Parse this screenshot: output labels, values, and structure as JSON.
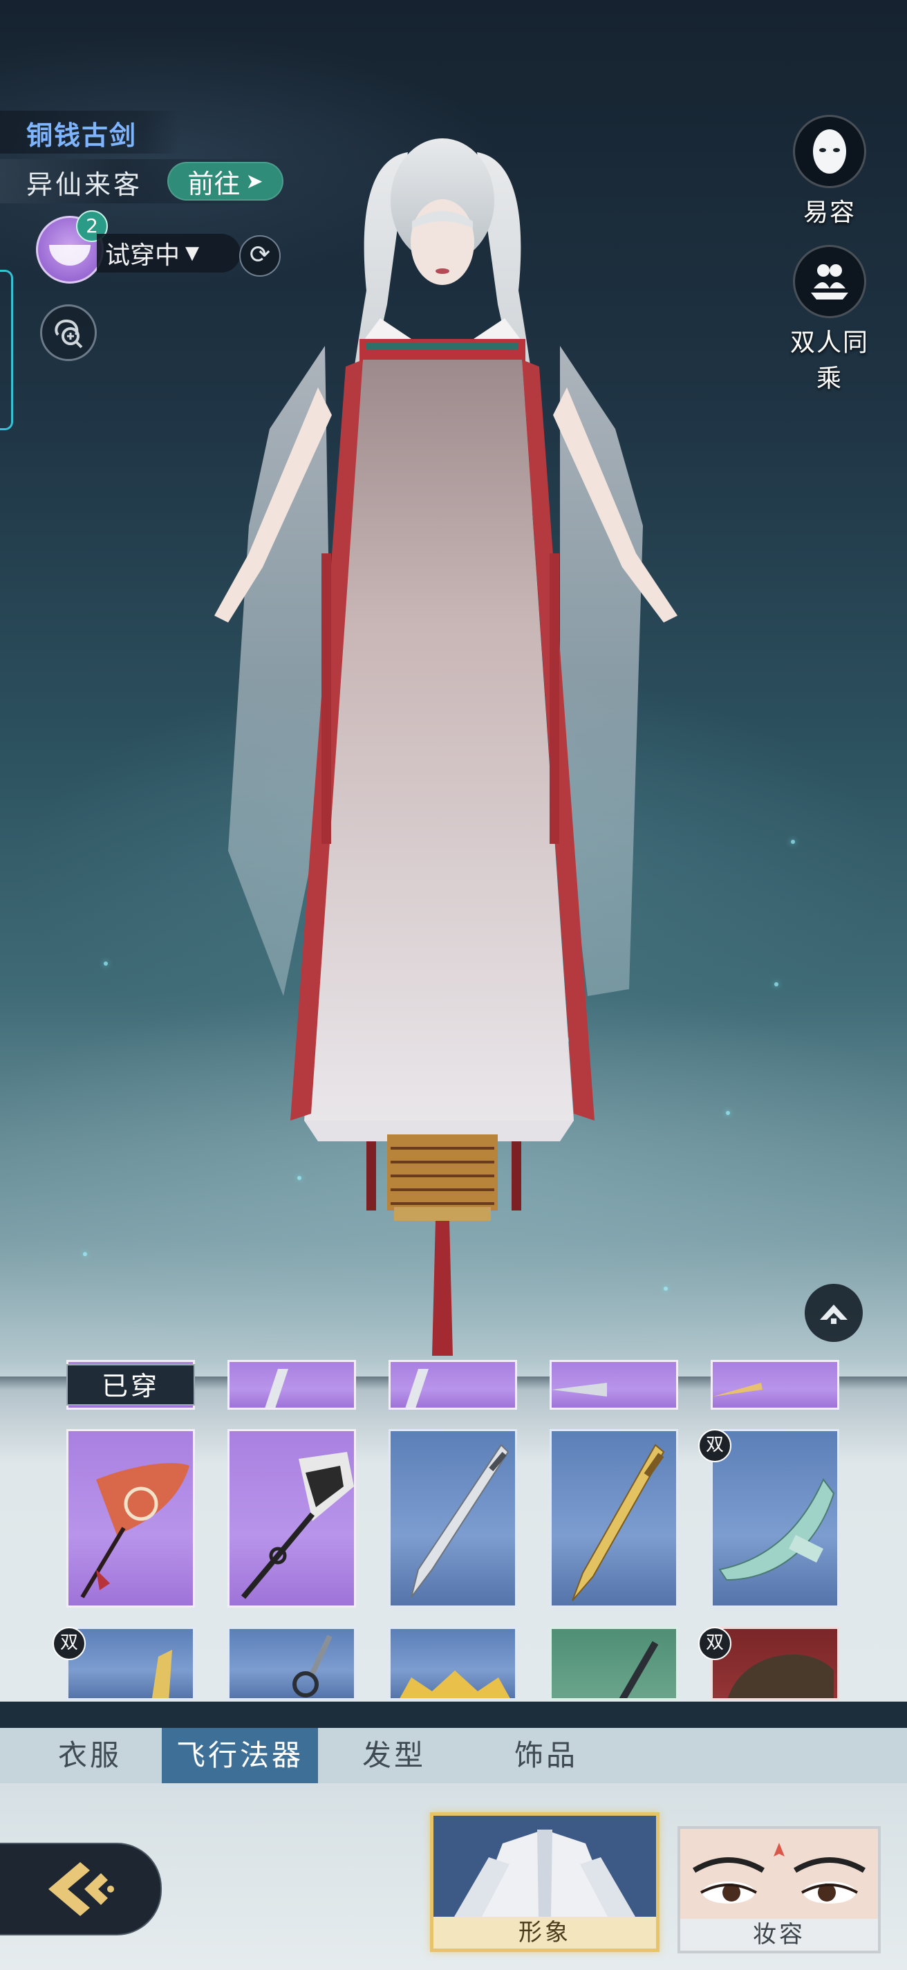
{
  "weapon": {
    "name": "铜钱古剑"
  },
  "source": {
    "name": "异仙来客",
    "goto_label": "前往"
  },
  "tryon": {
    "badge_count": "2",
    "status": "试穿中"
  },
  "right_actions": [
    {
      "label": "易容",
      "icon": "face-mask-icon"
    },
    {
      "label": "双人同乘",
      "icon": "two-riders-icon"
    }
  ],
  "inventory": {
    "worn_label": "已穿",
    "dual_badge": "双",
    "top_row": [
      "purple",
      "purple",
      "purple",
      "purple",
      "purple"
    ],
    "mid_row": [
      {
        "rarity": "purple",
        "item": "feather-staff",
        "dual": false
      },
      {
        "rarity": "purple",
        "item": "bone-staff",
        "dual": false
      },
      {
        "rarity": "blue",
        "item": "silver-sword",
        "dual": false
      },
      {
        "rarity": "blue",
        "item": "golden-sword",
        "dual": false
      },
      {
        "rarity": "blue",
        "item": "jade-blade",
        "dual": true
      }
    ],
    "bottom_row": [
      {
        "rarity": "blue",
        "dual": true
      },
      {
        "rarity": "blue",
        "dual": false
      },
      {
        "rarity": "blue",
        "dual": false
      },
      {
        "rarity": "green",
        "dual": false
      },
      {
        "rarity": "red",
        "dual": true
      }
    ]
  },
  "tabs": [
    {
      "label": "衣服",
      "active": false
    },
    {
      "label": "飞行法器",
      "active": true
    },
    {
      "label": "发型",
      "active": false
    },
    {
      "label": "饰品",
      "active": false
    }
  ],
  "cards": [
    {
      "label": "形象",
      "selected": true
    },
    {
      "label": "妆容",
      "selected": false
    }
  ],
  "colors": {
    "accent_blue": "#7fb5ff",
    "goto_green": "#2f8c78",
    "tab_active": "#3e6f97",
    "selected_gold": "#e7c46a",
    "rarity_purple": "#b894ea",
    "rarity_blue": "#7d9dd0",
    "rarity_green": "#6aa58b",
    "rarity_red": "#943436"
  }
}
